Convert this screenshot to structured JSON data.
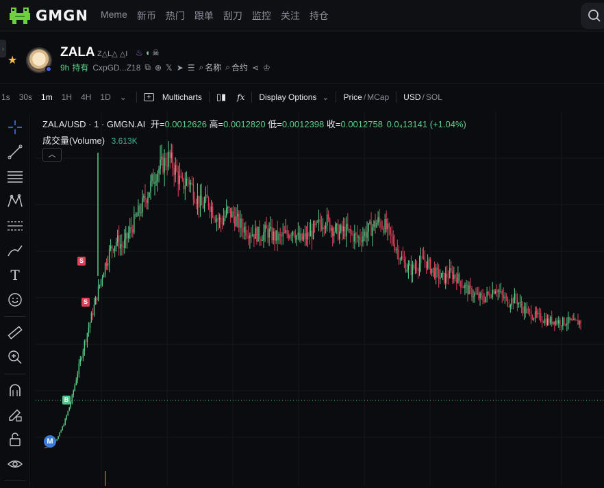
{
  "app": {
    "logo_text": "GMGN",
    "colors": {
      "up": "#5bd08a",
      "down": "#e0405a",
      "accent": "#f5c23b"
    }
  },
  "nav": {
    "items": [
      "Meme",
      "新币",
      "热门",
      "跟单",
      "刮刀",
      "监控",
      "关注",
      "持仓"
    ]
  },
  "token": {
    "name": "ZALA",
    "subtitle": "Z△L△ △I",
    "age": "9h",
    "holding_label": "持有",
    "address": "CxpGD...Z18",
    "name_search_label": "名称",
    "contract_search_label": "合约"
  },
  "toolbar": {
    "timeframes": [
      "1s",
      "30s",
      "1m",
      "1H",
      "4H",
      "1D"
    ],
    "active_timeframe": "1m",
    "multicharts_label": "Multicharts",
    "display_options_label": "Display Options",
    "price_label": "Price",
    "mcap_label": "MCap",
    "usd_label": "USD",
    "sol_label": "SOL"
  },
  "legend": {
    "symbol": "ZALA/USD · 1 · GMGN.AI",
    "open_label": "开=",
    "open": "0.0012626",
    "high_label": "高=",
    "high": "0.0012820",
    "low_label": "低=",
    "low": "0.0012398",
    "close_label": "收=",
    "close": "0.0012758",
    "change": "0.0₄13141",
    "change_pct": "(+1.04%)",
    "volume_label": "成交量(Volume)",
    "volume_value": "3.613K"
  },
  "markers": [
    {
      "type": "S",
      "label": "S"
    },
    {
      "type": "S",
      "label": "S"
    },
    {
      "type": "B",
      "label": "B"
    },
    {
      "type": "M",
      "label": "M"
    }
  ],
  "chart_data": {
    "type": "candlestick",
    "symbol": "ZALA/USD",
    "interval": "1m",
    "close_series": [
      9e-05,
      0.00012,
      0.00018,
      0.00032,
      0.00051,
      0.00078,
      0.00105,
      0.00128,
      0.00152,
      0.00176,
      0.00195,
      0.00204,
      0.00198,
      0.00212,
      0.00225,
      0.00238,
      0.00252,
      0.00268,
      0.00275,
      0.00282,
      0.00271,
      0.00255,
      0.00262,
      0.00248,
      0.00236,
      0.00242,
      0.00229,
      0.00221,
      0.00232,
      0.00226,
      0.00218,
      0.00214,
      0.00211,
      0.00209,
      0.00213,
      0.00208,
      0.00206,
      0.0021,
      0.00215,
      0.00204,
      0.00207,
      0.00212,
      0.00219,
      0.00224,
      0.00216,
      0.00211,
      0.00214,
      0.00209,
      0.00206,
      0.00211,
      0.00216,
      0.00222,
      0.00218,
      0.00207,
      0.00195,
      0.00182,
      0.00176,
      0.00181,
      0.00186,
      0.00179,
      0.00172,
      0.00168,
      0.00173,
      0.0017,
      0.00162,
      0.00156,
      0.00152,
      0.00149,
      0.00154,
      0.0016,
      0.00151,
      0.00146,
      0.0015,
      0.00141,
      0.00136,
      0.00133,
      0.00131,
      0.00128,
      0.00129,
      0.00127,
      0.00128,
      0.00126,
      0.00128
    ],
    "last_price": 0.0012758
  }
}
